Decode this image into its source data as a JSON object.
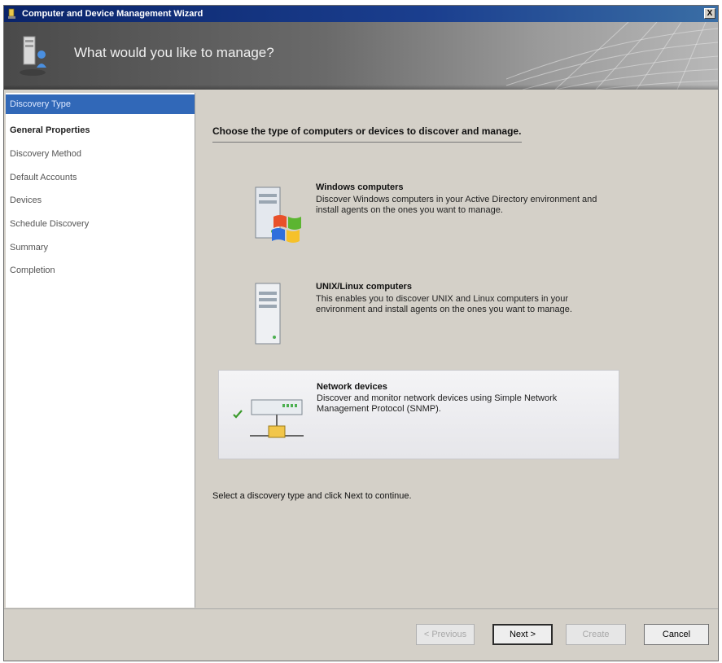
{
  "window": {
    "title": "Computer and Device Management Wizard",
    "close_glyph": "X"
  },
  "header": {
    "heading": "What would you like to manage?"
  },
  "sidebar": {
    "items": [
      {
        "label": "Discovery Type"
      },
      {
        "label": "General Properties"
      },
      {
        "label": "Discovery Method"
      },
      {
        "label": "Default Accounts"
      },
      {
        "label": "Devices"
      },
      {
        "label": "Schedule Discovery"
      },
      {
        "label": "Summary"
      },
      {
        "label": "Completion"
      }
    ]
  },
  "main": {
    "instruction": "Choose the type of computers or devices to discover and manage.",
    "options": [
      {
        "title": "Windows computers",
        "description": "Discover Windows computers in your Active Directory environment and install agents on the ones you want to manage.",
        "icon": "windows-computer-icon",
        "selected": false
      },
      {
        "title": "UNIX/Linux computers",
        "description": "This enables you to discover UNIX and Linux computers in your environment and install agents on the ones you want to manage.",
        "icon": "unix-computer-icon",
        "selected": false
      },
      {
        "title": "Network devices",
        "description": "Discover and monitor network devices using Simple Network Management Protocol (SNMP).",
        "icon": "network-device-icon",
        "selected": true
      }
    ],
    "hint": "Select a discovery type and click Next to continue."
  },
  "footer": {
    "previous_label": "< Previous",
    "next_label": "Next >",
    "create_label": "Create",
    "cancel_label": "Cancel"
  },
  "colors": {
    "selection_blue": "#3168b8",
    "banner_gray": "#6a6a6a",
    "window_face": "#d4d0c8"
  }
}
